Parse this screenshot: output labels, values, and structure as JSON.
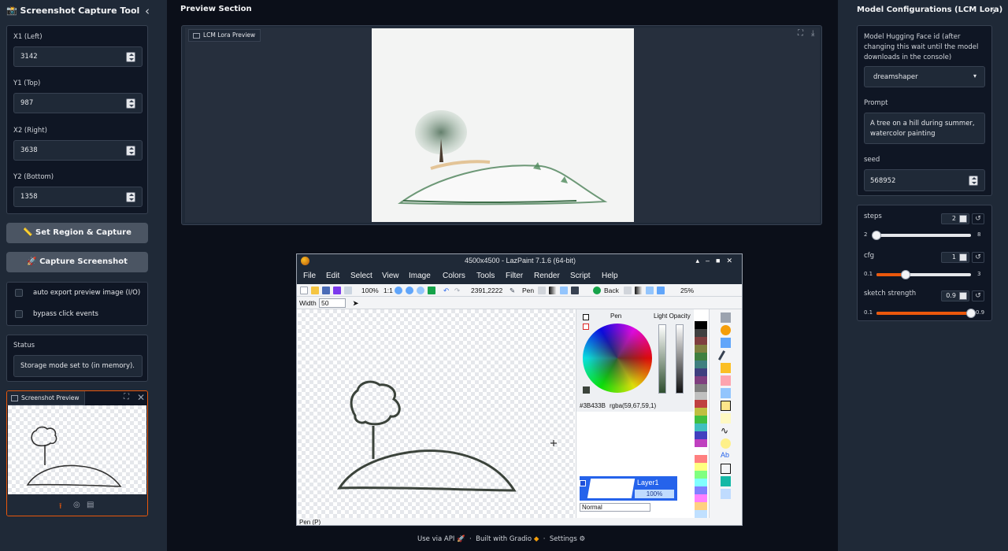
{
  "left": {
    "title": "Screenshot Capture Tool",
    "x1": {
      "label": "X1 (Left)",
      "value": "3142"
    },
    "y1": {
      "label": "Y1 (Top)",
      "value": "987"
    },
    "x2": {
      "label": "X2 (Right)",
      "value": "3638"
    },
    "y2": {
      "label": "Y2 (Bottom)",
      "value": "1358"
    },
    "set_region_button": "Set Region & Capture",
    "capture_button": "Capture Screenshot",
    "checkboxes": [
      "auto export preview image (I/O)",
      "bypass click events"
    ],
    "status_label": "Status",
    "status_value": "Storage mode set to (in memory).",
    "screenshot_preview_label": "Screenshot Preview"
  },
  "center": {
    "title": "Preview Section",
    "preview_label": "LCM Lora Preview"
  },
  "lazpaint": {
    "window_title": "4500x4500 - LazPaint 7.1.6 (64-bit)",
    "menus": [
      "File",
      "Edit",
      "Select",
      "View",
      "Image",
      "Colors",
      "Tools",
      "Filter",
      "Render",
      "Script",
      "Help"
    ],
    "zoom": "100%",
    "ratio": "1:1",
    "coords": "2391,2222",
    "tool_name": "Pen",
    "back_label": "Back",
    "zoom2": "25%",
    "width_label": "Width",
    "width_value": "50",
    "pen_label": "Pen",
    "light_opacity_label": "Light Opacity",
    "color_hex": "#3B433B",
    "color_rgba": "rgba(59,67,59,1)",
    "layer_name": "Layer1",
    "layer_opacity": "100%",
    "blend_mode": "Normal",
    "status": "Pen (P)",
    "palette": [
      "#000000",
      "#404040",
      "#7f3f3f",
      "#7f7f3f",
      "#3f7f3f",
      "#3f7f7f",
      "#3f3f7f",
      "#7f3f7f",
      "#808080",
      "#c0c0c0",
      "#bf4040",
      "#bfbf40",
      "#40bf40",
      "#40bfbf",
      "#4040bf",
      "#bf40bf",
      "#ffffff",
      "#ff8080",
      "#ffff80",
      "#80ff80",
      "#80ffff",
      "#8080ff",
      "#ff80ff",
      "#ffd080",
      "#c0e0ff"
    ]
  },
  "right": {
    "title": "Model Configurations (LCM Lora)",
    "model_label": "Model Hugging Face id (after changing this wait until the model downloads in the console)",
    "model_value": "dreamshaper",
    "prompt_label": "Prompt",
    "prompt_value": "A tree on a hill during summer, watercolor painting",
    "seed_label": "seed",
    "seed_value": "568952",
    "steps": {
      "label": "steps",
      "value": "2",
      "min": "2",
      "max": "8",
      "fraction": 0.0
    },
    "cfg": {
      "label": "cfg",
      "value": "1",
      "min": "0.1",
      "max": "3",
      "fraction": 0.31
    },
    "sketch": {
      "label": "sketch strength",
      "value": "0.9",
      "min": "0.1",
      "max": "0.9",
      "fraction": 1.0
    }
  },
  "footer": {
    "api": "Use via API",
    "built": "Built with Gradio",
    "settings": "Settings"
  },
  "colors": {
    "accent": "#ea580c",
    "background": "#0b0f19",
    "panel": "#1f2937",
    "layer_selected": "#2563eb"
  }
}
